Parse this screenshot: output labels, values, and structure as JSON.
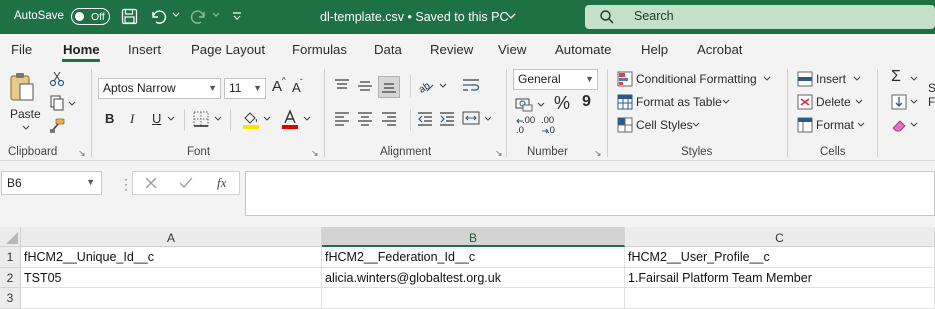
{
  "titlebar": {
    "autosave_label": "AutoSave",
    "autosave_state": "Off",
    "doc_title": "dl-template.csv • Saved to this PC",
    "search_placeholder": "Search"
  },
  "menu": {
    "tabs": [
      "File",
      "Home",
      "Insert",
      "Page Layout",
      "Formulas",
      "Data",
      "Review",
      "View",
      "Automate",
      "Help",
      "Acrobat"
    ],
    "active_tab": "Home"
  },
  "ribbon": {
    "clipboard": {
      "paste": "Paste",
      "label": "Clipboard"
    },
    "font": {
      "name": "Aptos Narrow",
      "size": "11",
      "grow": "A",
      "shrink": "A",
      "bold": "B",
      "italic": "I",
      "underline": "U",
      "label": "Font"
    },
    "alignment": {
      "label": "Alignment"
    },
    "number": {
      "format": "General",
      "percent": "%",
      "comma": "9",
      "inc_decimal": ".00",
      "dec_decimal": ".00",
      "label": "Number"
    },
    "styles": {
      "conditional": "Conditional Formatting",
      "format_table": "Format as Table",
      "cell_styles": "Cell Styles",
      "label": "Styles"
    },
    "cells": {
      "insert": "Insert",
      "delete": "Delete",
      "format": "Format",
      "label": "Cells"
    },
    "editing": {
      "sigma": "Σ"
    }
  },
  "formula_bar": {
    "name_box": "B6",
    "fx": "fx",
    "content": ""
  },
  "sheet": {
    "columns": [
      "A",
      "B",
      "C"
    ],
    "rows": [
      {
        "num": "1",
        "cells": [
          "fHCM2__Unique_Id__c",
          "fHCM2__Federation_Id__c",
          "fHCM2__User_Profile__c"
        ]
      },
      {
        "num": "2",
        "cells": [
          "TST05",
          "alicia.winters@globaltest.org.uk",
          "1.Fairsail Platform Team Member"
        ]
      },
      {
        "num": "3",
        "cells": [
          "",
          "",
          ""
        ]
      }
    ]
  },
  "colors": {
    "accent": "#1e7145",
    "search_bg": "#c5dfc8",
    "ribbon_bg": "#f3f3f3"
  }
}
